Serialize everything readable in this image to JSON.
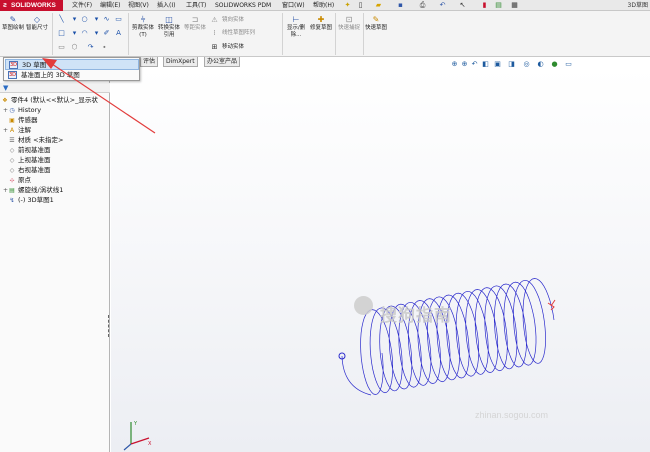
{
  "titlebar": {
    "logo": "SOLIDWORKS",
    "menus": [
      "文件(F)",
      "编辑(E)",
      "视图(V)",
      "插入(I)",
      "工具(T)",
      "SOLIDWORKS PDM",
      "窗口(W)",
      "帮助(H)"
    ],
    "window_title": "3D草图"
  },
  "ribbon": {
    "sketch": "草图绘制",
    "smart_dim": "智能尺寸",
    "trim": "剪裁实体(T)",
    "convert": "转换实体引用",
    "offset": "等距实体",
    "mirror": "镜向实体",
    "linear_pattern": "线性草图阵列",
    "move": "移动实体",
    "show_delete": "显示/删除...",
    "repair": "修复草图",
    "quick_snap": "快速捕捉",
    "rapid_sketch": "快速草图"
  },
  "dropdown": {
    "items": [
      "3D 草图",
      "基准面上的 3D 草图"
    ],
    "colors": {
      "highlight": "#cfe3f7"
    }
  },
  "tabs": [
    "评估",
    "DimXpert",
    "办公室产品"
  ],
  "tree": {
    "root": "零件4 (默认<<默认>_显示状",
    "items": [
      "History",
      "传感器",
      "注解",
      "材质 <未指定>",
      "前视基准面",
      "上视基准面",
      "右视基准面",
      "原点",
      "螺旋线/涡状线1",
      "(-) 3D草图1"
    ]
  },
  "watermark": {
    "text": "搜狗指南",
    "url": "zhinan.sogou.com"
  },
  "colors": {
    "helix": "#2a2acc",
    "arrow": "#e23c3c",
    "accent": "#c8102e"
  }
}
